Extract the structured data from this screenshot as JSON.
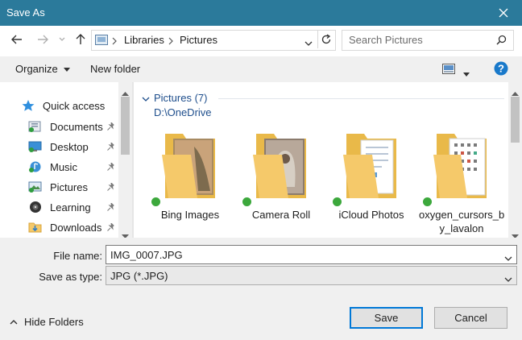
{
  "window": {
    "title": "Save As"
  },
  "address": {
    "crumbs": [
      "Libraries",
      "Pictures"
    ]
  },
  "search": {
    "placeholder": "Search Pictures"
  },
  "toolbar": {
    "organize": "Organize",
    "new_folder": "New folder"
  },
  "nav": {
    "items": [
      {
        "label": "Quick access"
      },
      {
        "label": "Documents"
      },
      {
        "label": "Desktop"
      },
      {
        "label": "Music"
      },
      {
        "label": "Pictures"
      },
      {
        "label": "Learning"
      },
      {
        "label": "Downloads"
      }
    ]
  },
  "content": {
    "group_title": "Pictures (7)",
    "group_path": "D:\\OneDrive",
    "folders": [
      {
        "name": "Bing Images"
      },
      {
        "name": "Camera Roll"
      },
      {
        "name": "iCloud Photos"
      },
      {
        "name_line1": "oxygen_cursors_b",
        "name_line2": "y_lavalon"
      }
    ]
  },
  "form": {
    "file_name_label": "File name:",
    "file_name_value": "IMG_0007.JPG",
    "type_label": "Save as type:",
    "type_value": "JPG (*.JPG)"
  },
  "footer": {
    "hide_folders": "Hide Folders",
    "save": "Save",
    "cancel": "Cancel"
  },
  "colors": {
    "titlebar": "#2b7a9b",
    "accent": "#0078d7",
    "folder": "#f5c96a",
    "sync_check": "#3ca83c"
  }
}
